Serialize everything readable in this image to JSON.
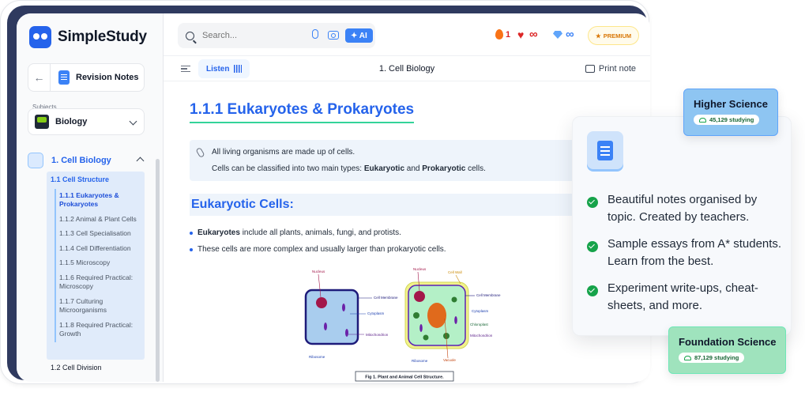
{
  "app": {
    "name": "SimpleStudy"
  },
  "sidebar": {
    "header_label": "Revision Notes",
    "subjects_label": "Subjects",
    "subject": "Biology",
    "chapter": "1. Cell Biology",
    "section": "1.1 Cell Structure",
    "topics": [
      {
        "label": "1.1.1 Eukaryotes & Prokaryotes",
        "active": true
      },
      {
        "label": "1.1.2 Animal & Plant Cells",
        "active": false
      },
      {
        "label": "1.1.3 Cell Specialisation",
        "active": false
      },
      {
        "label": "1.1.4 Cell Differentiation",
        "active": false
      },
      {
        "label": "1.1.5 Microscopy",
        "active": false
      },
      {
        "label": "1.1.6 Required Practical: Microscopy",
        "active": false
      },
      {
        "label": "1.1.7 Culturing Microorganisms",
        "active": false
      },
      {
        "label": "1.1.8 Required Practical: Growth",
        "active": false
      }
    ],
    "next_section": "1.2 Cell Division"
  },
  "topbar": {
    "search_placeholder": "Search...",
    "ai_label": "✦ AI",
    "streak_count": "1",
    "infinity": "∞",
    "premium_label": "PREMIUM"
  },
  "toolbar": {
    "listen_label": "Listen",
    "title": "1. Cell Biology",
    "print_label": "Print note"
  },
  "note": {
    "title": "1.1.1 Eukaryotes & Prokaryotes",
    "callout_line1": "All living organisms are made up of cells.",
    "callout_line2_pre": "Cells can be classified into two main types: ",
    "callout_eukaryotic": "Eukaryotic",
    "callout_and": " and ",
    "callout_prokaryotic": "Prokaryotic",
    "callout_end": " cells.",
    "heading": "Eukaryotic Cells:",
    "bullet1_bold": "Eukaryotes",
    "bullet1_rest": " include all plants, animals, fungi, and protists.",
    "bullet2": "These cells are more complex and usually larger than prokaryotic cells.",
    "figure": {
      "caption": "Fig 1. Plant and Animal Cell Structure.",
      "animal_labels": [
        "Nucleus",
        "Cell Membrane",
        "Cytoplasm",
        "Mitochondrion",
        "Ribosome"
      ],
      "plant_labels": [
        "Nucleus",
        "Cell Wall",
        "Cell Membrane",
        "Cytoplasm",
        "Chloroplast",
        "Mitochondrion",
        "Ribosome",
        "Vacuole"
      ]
    }
  },
  "features": {
    "items": [
      "Beautiful notes organised by topic. Created by teachers.",
      "Sample essays from A* students. Learn from the best.",
      "Experiment write-ups, cheat-sheets, and more."
    ]
  },
  "cards": {
    "higher": {
      "title": "Higher Science",
      "studying": "45,129 studying"
    },
    "foundation": {
      "title": "Foundation Science",
      "studying": "87,129 studying"
    }
  },
  "colors": {
    "brand": "#2563eb",
    "accent_green": "#16a34a",
    "streak": "#dc2626"
  }
}
